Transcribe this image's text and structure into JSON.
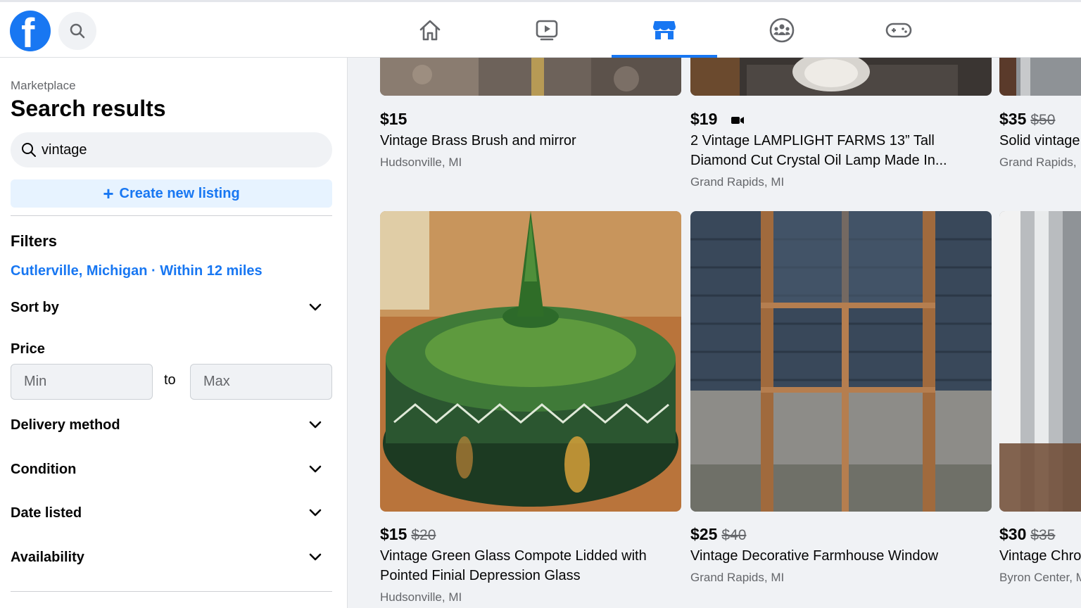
{
  "nav": {
    "icons": [
      "home-icon",
      "watch-icon",
      "marketplace-icon",
      "groups-icon",
      "gaming-icon"
    ],
    "active": "marketplace-icon",
    "accent": "#1877f2"
  },
  "sidebar": {
    "breadcrumb": "Marketplace",
    "title": "Search results",
    "search_value": "vintage",
    "create_label": "Create new listing",
    "filters_title": "Filters",
    "location": "Cutlerville, Michigan · Within 12 miles",
    "sort_by": "Sort by",
    "price_label": "Price",
    "price_min_placeholder": "Min",
    "price_to": "to",
    "price_max_placeholder": "Max",
    "delivery": "Delivery method",
    "condition": "Condition",
    "date_listed": "Date listed",
    "availability": "Availability"
  },
  "listings": [
    {
      "price": "$15",
      "old_price": "",
      "title": "Vintage Brass Brush and mirror",
      "location": "Hudsonville, MI"
    },
    {
      "price": "$19",
      "old_price": "",
      "title": "2 Vintage LAMPLIGHT FARMS 13” Tall Diamond Cut Crystal Oil Lamp Made In...",
      "location": "Grand Rapids, MI",
      "video": true
    },
    {
      "price": "$35",
      "old_price": "$50",
      "title": "Solid vintage",
      "location": "Grand Rapids, "
    },
    {
      "price": "$15",
      "old_price": "$20",
      "title": "Vintage Green Glass Compote Lidded with Pointed Finial Depression Glass",
      "location": "Hudsonville, MI"
    },
    {
      "price": "$25",
      "old_price": "$40",
      "title": "Vintage Decorative Farmhouse Window",
      "location": "Grand Rapids, MI"
    },
    {
      "price": "$30",
      "old_price": "$35",
      "title": "Vintage Chro",
      "location": "Byron Center, M"
    }
  ]
}
